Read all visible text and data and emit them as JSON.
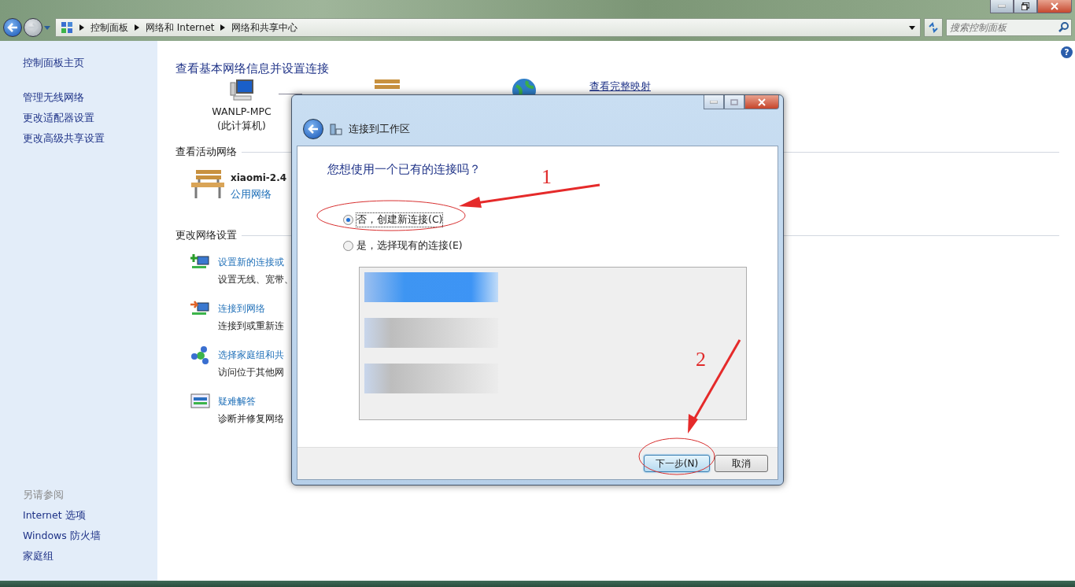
{
  "address_bar": {
    "breadcrumb": [
      "控制面板",
      "网络和 Internet",
      "网络和共享中心"
    ],
    "search": {
      "placeholder": "搜索控制面板"
    }
  },
  "help": "?",
  "sidebar": {
    "items": [
      "控制面板主页",
      "管理无线网络",
      "更改适配器设置",
      "更改高级共享设置"
    ],
    "see_also": {
      "title": "另请参阅",
      "items": [
        "Internet 选项",
        "Windows 防火墙",
        "家庭组"
      ]
    }
  },
  "main": {
    "title": "查看基本网络信息并设置连接",
    "map": {
      "computer_name": "WANLP-MPC",
      "computer_note": "(此计算机)",
      "full_map_link": "查看完整映射"
    },
    "active_networks": {
      "heading": "查看活动网络",
      "network": {
        "name": "xiaomi-2.4",
        "type": "公用网络"
      }
    },
    "change_settings": {
      "heading": "更改网络设置",
      "tasks": [
        {
          "kind": "new-connection",
          "title": "设置新的连接或",
          "description": "设置无线、宽带、"
        },
        {
          "kind": "connect",
          "title": "连接到网络",
          "description": "连接到或重新连"
        },
        {
          "kind": "homegroup",
          "title": "选择家庭组和共",
          "description": "访问位于其他网"
        },
        {
          "kind": "troubleshoot",
          "title": "疑难解答",
          "description": "诊断并修复网络"
        }
      ]
    }
  },
  "dialog": {
    "title": "连接到工作区",
    "question": "您想使用一个已有的连接吗？",
    "options": [
      {
        "label": "否，创建新连接(C)",
        "selected": true
      },
      {
        "label": "是，选择现有的连接(E)",
        "selected": false
      }
    ],
    "existing_connections": {
      "disabled": true
    },
    "buttons": [
      {
        "label": "下一步(N)",
        "kind": "default"
      },
      {
        "label": "取消",
        "kind": "normal"
      }
    ]
  },
  "annotations": [
    {
      "label": "1"
    },
    {
      "label": "2"
    }
  ]
}
